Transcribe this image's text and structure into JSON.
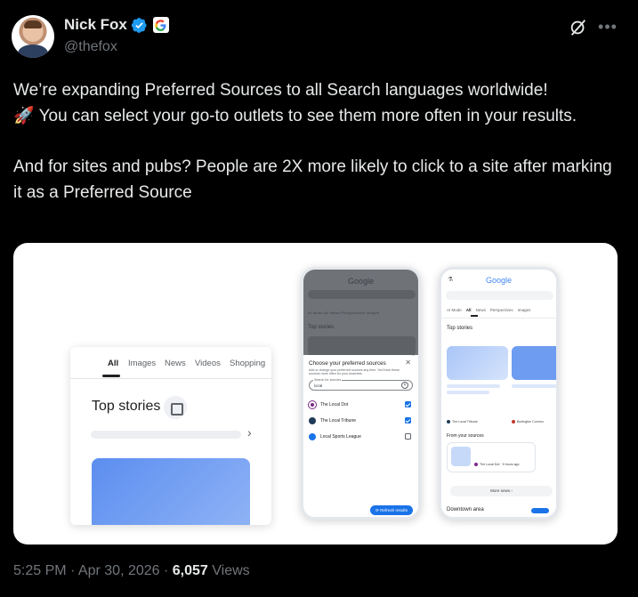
{
  "author": {
    "name": "Nick Fox",
    "handle": "@thefox"
  },
  "tweet": {
    "line1": "We’re expanding Preferred Sources to all Search languages worldwide!",
    "line2": "🚀 You can select your go-to outlets to see them more often in your results.",
    "line3": "And for sites and pubs? People are 2X more likely to click to a site after marking it as a Preferred Source"
  },
  "icons": {
    "grok": "grok-icon",
    "more": "more-icon",
    "verified": "verified-badge-icon",
    "affiliate": "google-g-icon"
  },
  "media": {
    "desktop_card": {
      "tabs": [
        "All",
        "Images",
        "News",
        "Videos",
        "Shopping"
      ],
      "active_tab": "All",
      "section_title": "Top stories"
    },
    "phone1": {
      "logo": "Google",
      "tabs": "AI Mode   All   News   Perspectives   Images",
      "section_title": "Top stories",
      "sheet_title": "Choose your preferred sources",
      "sheet_subtitle": "Add or change your preferred sources any time. You'll see these sources more often for your searches.",
      "search_label": "Search for sources",
      "search_value": "local",
      "sources": [
        {
          "name": "The Local Dot",
          "checked": true,
          "color": "#7b2a8a"
        },
        {
          "name": "The Local Tribune",
          "checked": true,
          "color": "#1f3b57"
        },
        {
          "name": "Local Sports League",
          "checked": false,
          "color": "#1a73e8"
        }
      ],
      "refresh_label": "⟳ Refresh results"
    },
    "phone2": {
      "logo": "Google",
      "tabs": [
        "AI Mode",
        "All",
        "News",
        "Perspectives",
        "Images"
      ],
      "active_tab": "All",
      "section_title": "Top stories",
      "source1": "The Local Tribune",
      "source2": "Burlington Commu",
      "from_sources": "From your sources",
      "card_source": "The Local Dot",
      "card_time": "5 hours ago",
      "more_news": "More news ›",
      "bottom_title": "Downtown area"
    }
  },
  "meta": {
    "time": "5:25 PM · Apr 30, 2026 ·",
    "views_count": "6,057",
    "views_label": "Views"
  }
}
